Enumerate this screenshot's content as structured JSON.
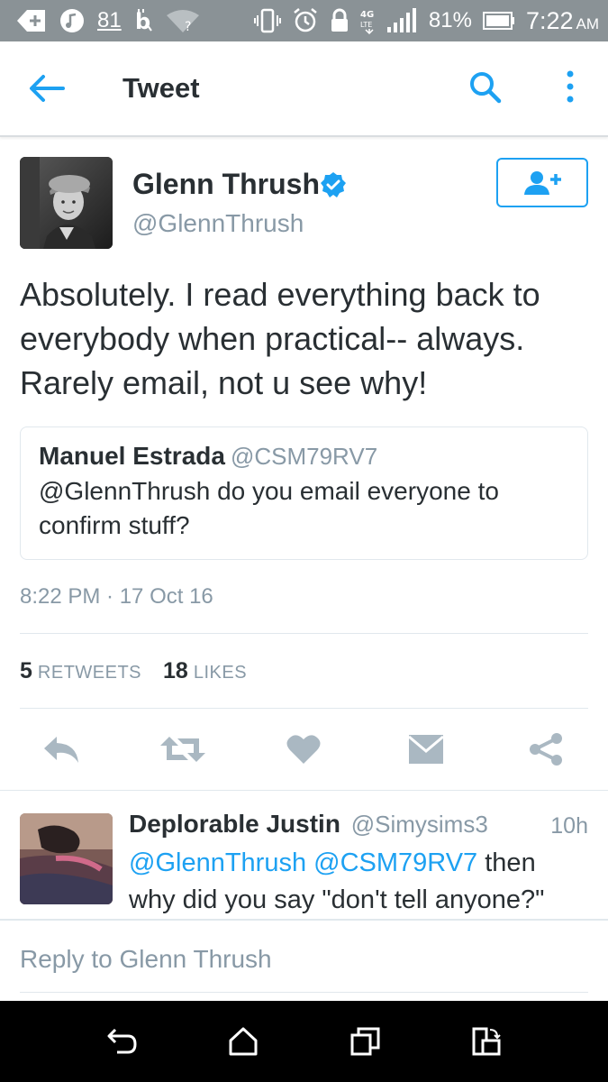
{
  "status_bar": {
    "notification_count": "81",
    "battery_percent": "81%",
    "time": "7:22",
    "ampm": "AM",
    "network_label": "4G LTE",
    "icons": [
      "add-notification-icon",
      "music-icon",
      "bitcoin-icon",
      "wifi-question-icon",
      "vibrate-icon",
      "alarm-icon",
      "lock-icon",
      "signal-icon",
      "battery-icon"
    ]
  },
  "app_bar": {
    "title": "Tweet",
    "icons": [
      "back-arrow-icon",
      "search-icon",
      "more-vertical-icon"
    ]
  },
  "tweet": {
    "author_name": "Glenn Thrush",
    "author_handle": "@GlennThrush",
    "verified": true,
    "text": "Absolutely. I read everything back to everybody when practical-- always. Rarely email, not u see why!",
    "quoted": {
      "author_name": "Manuel Estrada",
      "author_handle": "@CSM79RV7",
      "text": "@GlennThrush do you email everyone to confirm stuff?"
    },
    "timestamp": "8:22 PM · 17 Oct 16",
    "retweet_count": "5",
    "retweet_label": "RETWEETS",
    "like_count": "18",
    "like_label": "LIKES"
  },
  "actions": [
    "reply-icon",
    "retweet-icon",
    "like-icon",
    "direct-message-icon",
    "share-icon"
  ],
  "reply": {
    "author_name": "Deplorable Justin",
    "author_handle": "@Simysims3",
    "time": "10h",
    "mention_1": "@GlennThrush",
    "mention_2": "@CSM79RV7",
    "text_rest": "then why did you say \"don't tell anyone?\""
  },
  "compose": {
    "placeholder": "Reply to Glenn Thrush"
  },
  "colors": {
    "accent": "#1da1f2",
    "text_primary": "#292f33",
    "text_secondary": "#8899a6",
    "status_bar": "#8a9296",
    "icon_gray": "#aab8c2",
    "nav_bar": "#000000"
  }
}
